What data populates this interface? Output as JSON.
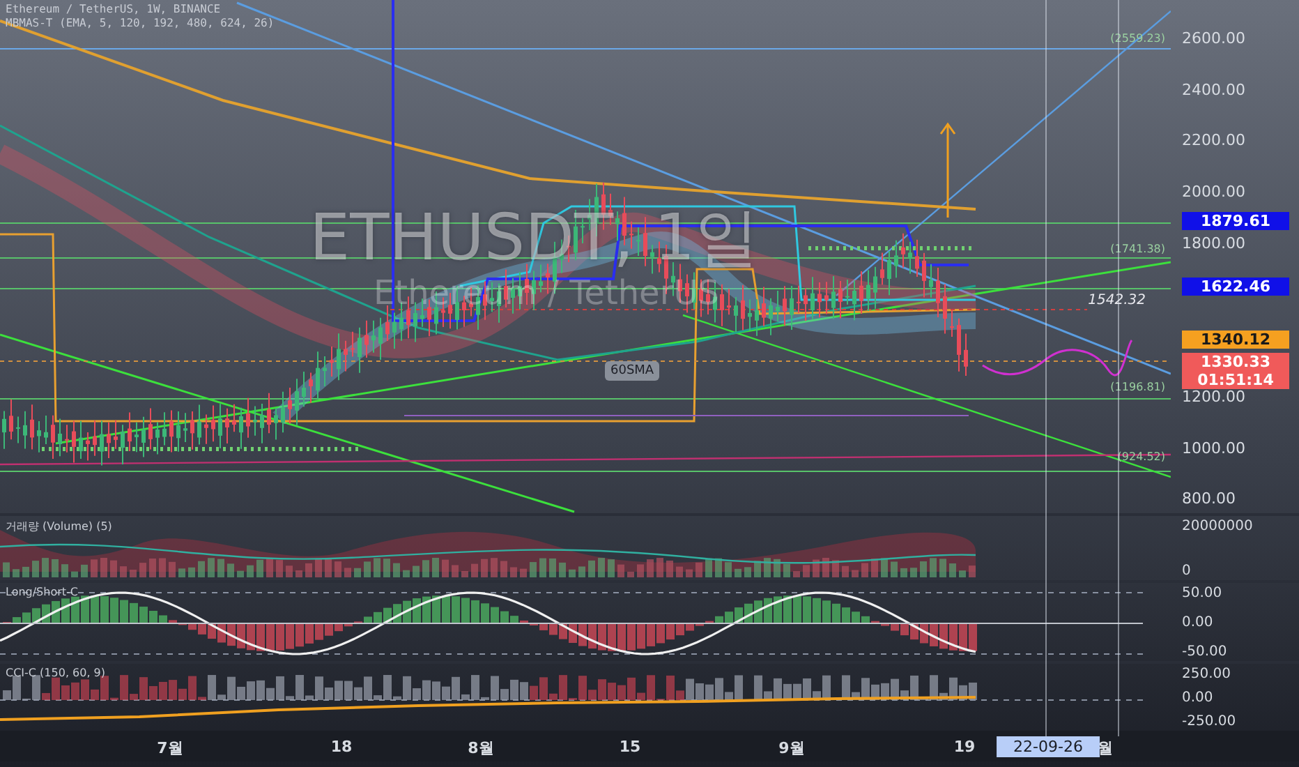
{
  "header": {
    "symbol_line": "Ethereum / TetherUS, 1W, BINANCE",
    "indicator_line": "MBMAS-T (EMA, 5, 120, 192, 480, 624, 26)"
  },
  "watermark": {
    "symbol": "ETHUSDT, 1일",
    "description": "Ethereum / TetherUS"
  },
  "main_chart": {
    "sma_tag": "60SMA",
    "line_labels": [
      {
        "text": "(2559.23)",
        "kind": "bracket"
      },
      {
        "text": "(1741.38)",
        "kind": "bracket"
      },
      {
        "text": "1542.32",
        "kind": "plain"
      },
      {
        "text": "(1196.81)",
        "kind": "bracket"
      },
      {
        "text": "(924.52)",
        "kind": "bracket"
      }
    ],
    "price_scale": [
      "2600.00",
      "2400.00",
      "2200.00",
      "2000.00",
      "1800.00",
      "1200.00",
      "1000.00",
      "800.00"
    ],
    "price_badges": [
      {
        "text": "1879.61",
        "kind": "level"
      },
      {
        "text": "1622.46",
        "kind": "level"
      },
      {
        "text": "1340.12",
        "kind": "current"
      },
      {
        "text": "1330.33",
        "kind": "last",
        "countdown": "01:51:14"
      }
    ]
  },
  "volume_pane": {
    "title": "거래량 (Volume) (5)",
    "scale": [
      "20000000",
      "0"
    ]
  },
  "long_short_pane": {
    "title": "Long/Short-C",
    "scale": [
      "50.00",
      "0.00",
      "-50.00"
    ]
  },
  "cci_pane": {
    "title": "CCI-C (150, 60, 9)",
    "scale": [
      "250.00",
      "0.00",
      "-250.00"
    ]
  },
  "time_axis": {
    "labels": [
      {
        "text": "7월",
        "selected": false
      },
      {
        "text": "18",
        "selected": false
      },
      {
        "text": "8월",
        "selected": false
      },
      {
        "text": "15",
        "selected": false
      },
      {
        "text": "9월",
        "selected": false
      },
      {
        "text": "19",
        "selected": false
      },
      {
        "text": "22-09-26",
        "selected": true
      },
      {
        "text": "월",
        "selected": false
      }
    ]
  }
}
